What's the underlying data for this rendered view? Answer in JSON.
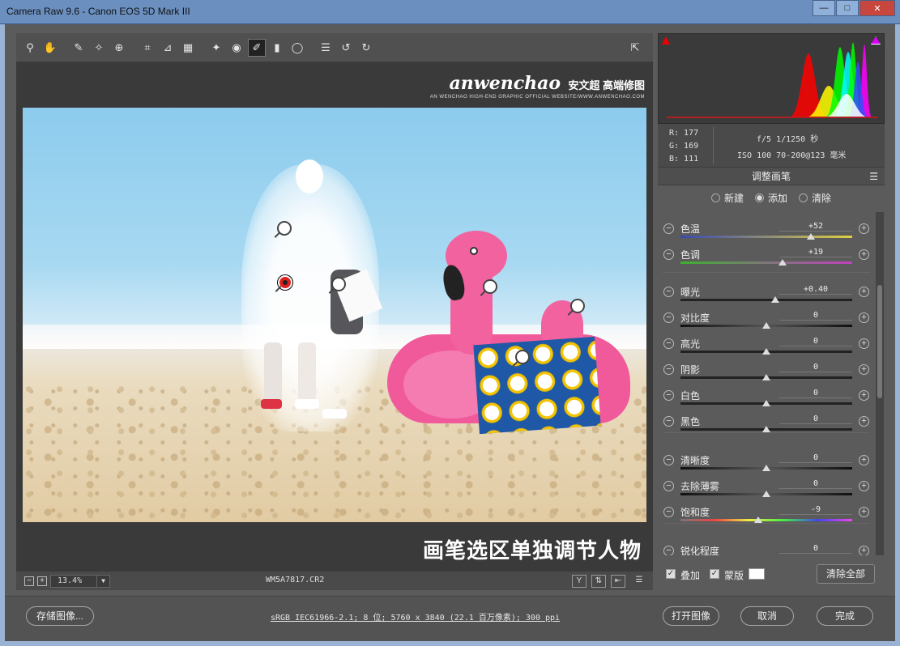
{
  "window": {
    "title": "Camera Raw 9.6 -  Canon EOS 5D Mark III",
    "minimize": "—",
    "maximize": "□",
    "close": "✕"
  },
  "toolbar": {
    "tools": [
      {
        "name": "zoom-tool-icon",
        "glyph": "⚲"
      },
      {
        "name": "hand-tool-icon",
        "glyph": "✋"
      },
      {
        "name": "white-balance-tool-icon",
        "glyph": "✎"
      },
      {
        "name": "color-sampler-tool-icon",
        "glyph": "✧"
      },
      {
        "name": "targeted-adjustment-tool-icon",
        "glyph": "⊕"
      },
      {
        "name": "crop-tool-icon",
        "glyph": "⌗"
      },
      {
        "name": "straighten-tool-icon",
        "glyph": "⊿"
      },
      {
        "name": "transform-tool-icon",
        "glyph": "▦"
      },
      {
        "name": "spot-removal-tool-icon",
        "glyph": "✦"
      },
      {
        "name": "red-eye-tool-icon",
        "glyph": "◉"
      },
      {
        "name": "adjustment-brush-tool-icon",
        "glyph": "✐",
        "active": true
      },
      {
        "name": "graduated-filter-tool-icon",
        "glyph": "▮"
      },
      {
        "name": "radial-filter-tool-icon",
        "glyph": "◯"
      },
      {
        "name": "preferences-icon",
        "glyph": "☰"
      },
      {
        "name": "rotate-left-icon",
        "glyph": "↺"
      },
      {
        "name": "rotate-right-icon",
        "glyph": "↻"
      }
    ],
    "fullscreen_glyph": "⇱"
  },
  "watermark": {
    "main": "anwenchao",
    "cn": "安文超 高端修图",
    "sub": "AN WENCHAO HIGH-END GRAPHIC OFFICIAL WEBSITE/WWW.ANWENCHAO.COM"
  },
  "image_caption": "画笔选区单独调节人物",
  "statusbar": {
    "zoom_out": "−",
    "zoom_in": "+",
    "zoom_value": "13.4%",
    "filename": "WM5A7817.CR2"
  },
  "histogram": {
    "colors": {
      "red": "#ff0000",
      "green": "#00ff00",
      "blue": "#3050ff",
      "cyan": "#00ffff",
      "magenta": "#ff00ff",
      "yellow": "#ffff00",
      "white": "#ffffff"
    }
  },
  "readout": {
    "r": "R:  177",
    "g": "G:  169",
    "b": "B:  111",
    "exposure": "f/5   1/1250 秒",
    "iso_lens": "ISO 100   70-200@123 毫米"
  },
  "panel": {
    "title": "调整画笔",
    "modes": [
      {
        "label": "新建",
        "selected": false
      },
      {
        "label": "添加",
        "selected": true
      },
      {
        "label": "清除",
        "selected": false
      }
    ],
    "sliders": [
      {
        "label": "色温",
        "value": "+52",
        "level": 0.76,
        "track": "temp"
      },
      {
        "label": "色调",
        "value": "+19",
        "level": 0.595,
        "track": "tint"
      },
      {
        "label": "曝光",
        "value": "+0.40",
        "level": 0.55,
        "track": "plain"
      },
      {
        "label": "对比度",
        "value": "0",
        "level": 0.5,
        "track": "dash"
      },
      {
        "label": "高光",
        "value": "0",
        "level": 0.5,
        "track": "plain"
      },
      {
        "label": "阴影",
        "value": "0",
        "level": 0.5,
        "track": "plain"
      },
      {
        "label": "白色",
        "value": "0",
        "level": 0.5,
        "track": "plain"
      },
      {
        "label": "黑色",
        "value": "0",
        "level": 0.5,
        "track": "plain"
      },
      {
        "label": "清晰度",
        "value": "0",
        "level": 0.5,
        "track": "dash"
      },
      {
        "label": "去除薄雾",
        "value": "0",
        "level": 0.5,
        "track": "dash"
      },
      {
        "label": "饱和度",
        "value": "-9",
        "level": 0.455,
        "track": "sat"
      },
      {
        "label": "锐化程度",
        "value": "0",
        "level": 0.5,
        "track": "plain"
      }
    ],
    "overlay_label": "叠加",
    "mask_label": "蒙版",
    "clear_all": "清除全部"
  },
  "bottom": {
    "save": "存储图像...",
    "workflow": "sRGB IEC61966-2.1; 8 位; 5760 x 3840 (22.1 百万像素); 300 ppi",
    "open": "打开图像",
    "cancel": "取消",
    "done": "完成"
  }
}
